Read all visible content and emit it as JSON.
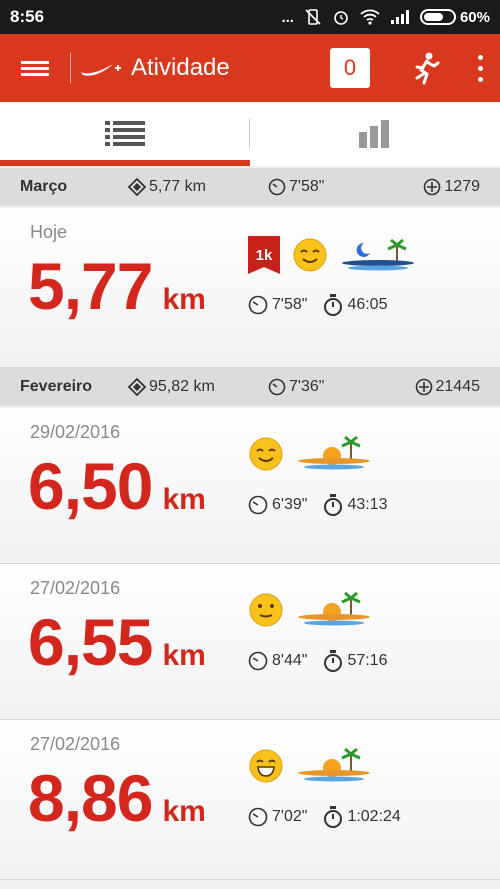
{
  "status_bar": {
    "time": "8:56",
    "dots": "...",
    "battery": "60%"
  },
  "app_bar": {
    "title": "Atividade",
    "count": "0"
  },
  "colors": {
    "accent": "#d8391e",
    "distance": "#d3261c"
  },
  "months": [
    {
      "name": "Março",
      "distance": "5,77 km",
      "pace": "7'58\"",
      "fuel": "1279"
    },
    {
      "name": "Fevereiro",
      "distance": "95,82 km",
      "pace": "7'36\"",
      "fuel": "21445"
    }
  ],
  "runs": [
    {
      "date": "Hoje",
      "distance": "5,77",
      "unit": "km",
      "pace": "7'58\"",
      "duration": "46:05",
      "badge": "1k",
      "mood": "content",
      "weather": "night-beach"
    },
    {
      "date": "29/02/2016",
      "distance": "6,50",
      "unit": "km",
      "pace": "6'39\"",
      "duration": "43:13",
      "mood": "content",
      "weather": "sunny-beach"
    },
    {
      "date": "27/02/2016",
      "distance": "6,55",
      "unit": "km",
      "pace": "8'44\"",
      "duration": "57:16",
      "mood": "neutral",
      "weather": "sunny-beach"
    },
    {
      "date": "27/02/2016",
      "distance": "8,86",
      "unit": "km",
      "pace": "7'02\"",
      "duration": "1:02:24",
      "mood": "happy",
      "weather": "sunny-beach"
    }
  ]
}
